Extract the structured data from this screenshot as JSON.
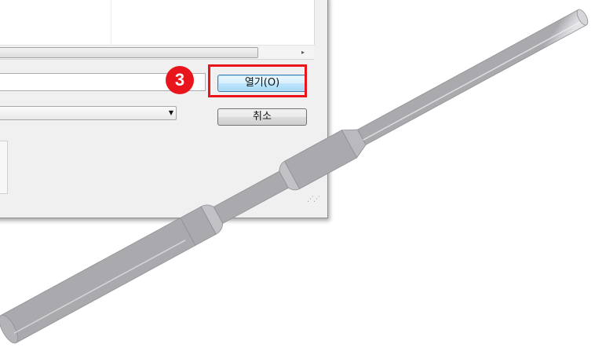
{
  "dialog": {
    "buttons": {
      "open_label": "열기(O)",
      "cancel_label": "취소"
    },
    "filename_value": "",
    "filetype_value": "",
    "scroll_right_arrow": "▸",
    "dropdown_arrow": "▼"
  },
  "annotation": {
    "step_number": "3",
    "color": "#e8161c"
  },
  "model_preview": {
    "object": "shaft-3d-model",
    "color": "#c9c9cd"
  }
}
